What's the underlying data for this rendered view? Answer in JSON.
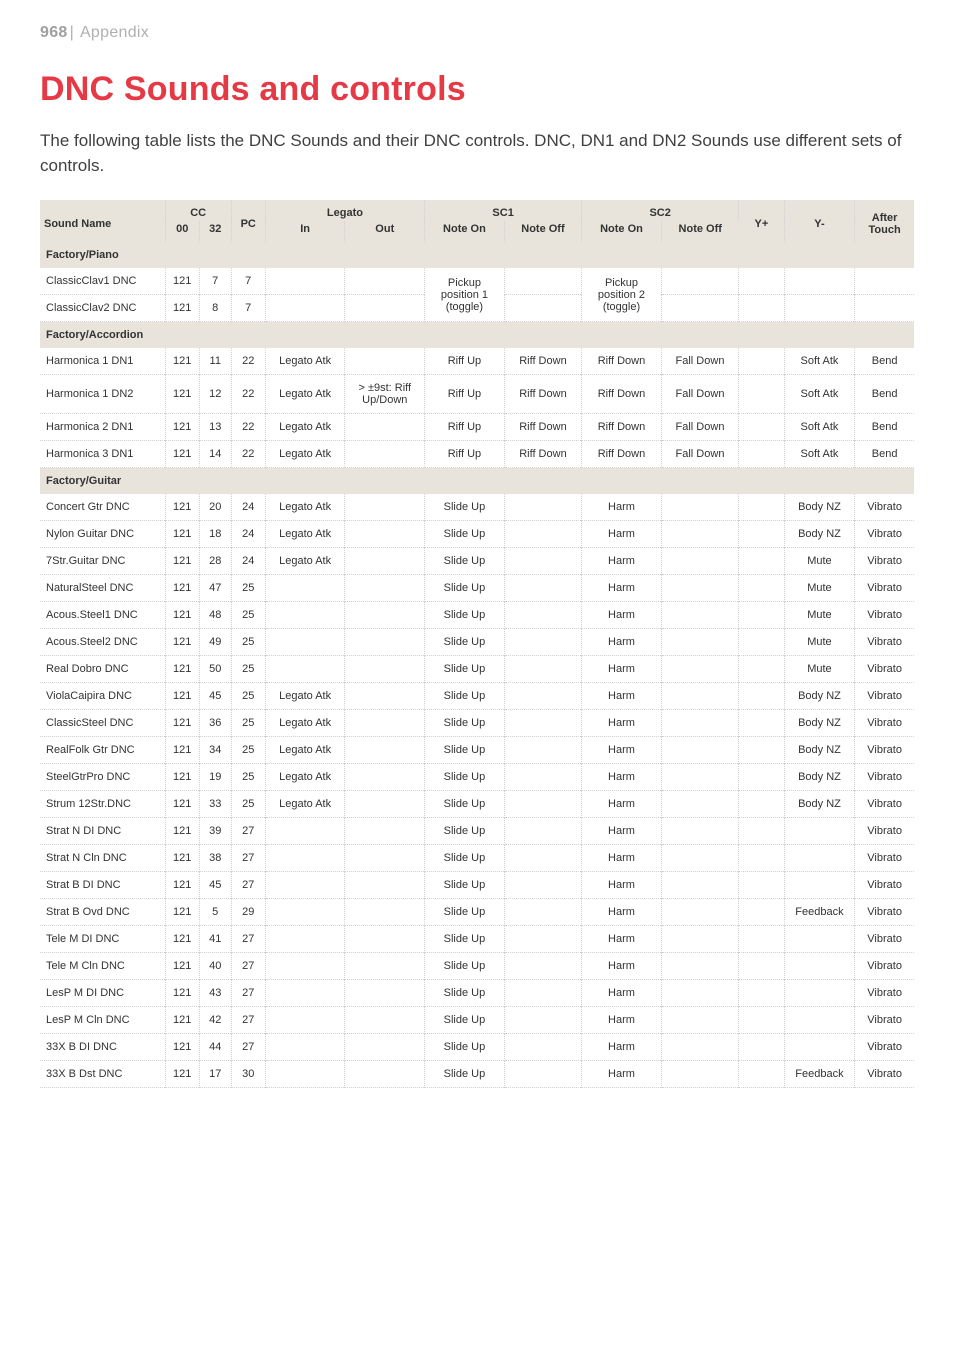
{
  "header": {
    "page_number": "968",
    "divider": "|",
    "section": "Appendix"
  },
  "title": "DNC Sounds and controls",
  "intro": "The following table lists the DNC Sounds and their DNC controls. DNC, DN1 and DN2 Sounds use different sets of controls.",
  "table": {
    "head_row1": {
      "sound_name": "Sound Name",
      "cc": "CC",
      "pc": "PC",
      "legato": "Legato",
      "sc1": "SC1",
      "sc2": "SC2",
      "yp": "Y+",
      "ym": "Y-",
      "after": "After Touch"
    },
    "head_row2": {
      "cc00": "00",
      "cc32": "32",
      "in": "In",
      "out": "Out",
      "noteon1": "Note On",
      "noteoff1": "Note Off",
      "noteon2": "Note On",
      "noteoff2": "Note Off"
    },
    "sections": [
      {
        "label": "Factory/Piano",
        "rows": [
          {
            "name": "ClassicClav1 DNC",
            "cc00": "121",
            "cc32": "7",
            "pc": "7",
            "legin": "",
            "legout": "",
            "sc1on": "Pickup position 1 (toggle)",
            "sc1off": "",
            "sc2on": "Pickup position 2 (toggle)",
            "sc2off": "",
            "yp": "",
            "ym": "",
            "after": "",
            "rowspan_sc1": 2,
            "rowspan_sc2": 2
          },
          {
            "name": "ClassicClav2 DNC",
            "cc00": "121",
            "cc32": "8",
            "pc": "7",
            "legin": "",
            "legout": "",
            "sc1off": "",
            "sc2off": "",
            "yp": "",
            "ym": "",
            "after": "",
            "skip_sc1": true,
            "skip_sc2": true
          }
        ]
      },
      {
        "label": "Factory/Accordion",
        "rows": [
          {
            "name": "Harmonica 1 DN1",
            "cc00": "121",
            "cc32": "11",
            "pc": "22",
            "legin": "Legato Atk",
            "legout": "",
            "sc1on": "Riff Up",
            "sc1off": "Riff Down",
            "sc2on": "Riff Down",
            "sc2off": "Fall Down",
            "yp": "",
            "ym": "Soft Atk",
            "after": "Bend"
          },
          {
            "name": "Harmonica 1 DN2",
            "cc00": "121",
            "cc32": "12",
            "pc": "22",
            "legin": "Legato Atk",
            "legout": "> ±9st: Riff Up/Down",
            "sc1on": "Riff Up",
            "sc1off": "Riff Down",
            "sc2on": "Riff Down",
            "sc2off": "Fall Down",
            "yp": "",
            "ym": "Soft Atk",
            "after": "Bend"
          },
          {
            "name": "Harmonica 2 DN1",
            "cc00": "121",
            "cc32": "13",
            "pc": "22",
            "legin": "Legato Atk",
            "legout": "",
            "sc1on": "Riff Up",
            "sc1off": "Riff Down",
            "sc2on": "Riff Down",
            "sc2off": "Fall Down",
            "yp": "",
            "ym": "Soft Atk",
            "after": "Bend"
          },
          {
            "name": "Harmonica 3 DN1",
            "cc00": "121",
            "cc32": "14",
            "pc": "22",
            "legin": "Legato Atk",
            "legout": "",
            "sc1on": "Riff Up",
            "sc1off": "Riff Down",
            "sc2on": "Riff Down",
            "sc2off": "Fall Down",
            "yp": "",
            "ym": "Soft Atk",
            "after": "Bend"
          }
        ]
      },
      {
        "label": "Factory/Guitar",
        "rows": [
          {
            "name": "Concert Gtr DNC",
            "cc00": "121",
            "cc32": "20",
            "pc": "24",
            "legin": "Legato Atk",
            "legout": "",
            "sc1on": "Slide Up",
            "sc1off": "",
            "sc2on": "Harm",
            "sc2off": "",
            "yp": "",
            "ym": "Body NZ",
            "after": "Vibrato"
          },
          {
            "name": "Nylon Guitar DNC",
            "cc00": "121",
            "cc32": "18",
            "pc": "24",
            "legin": "Legato Atk",
            "legout": "",
            "sc1on": "Slide Up",
            "sc1off": "",
            "sc2on": "Harm",
            "sc2off": "",
            "yp": "",
            "ym": "Body NZ",
            "after": "Vibrato"
          },
          {
            "name": "7Str.Guitar DNC",
            "cc00": "121",
            "cc32": "28",
            "pc": "24",
            "legin": "Legato Atk",
            "legout": "",
            "sc1on": "Slide Up",
            "sc1off": "",
            "sc2on": "Harm",
            "sc2off": "",
            "yp": "",
            "ym": "Mute",
            "after": "Vibrato"
          },
          {
            "name": "NaturalSteel DNC",
            "cc00": "121",
            "cc32": "47",
            "pc": "25",
            "legin": "",
            "legout": "",
            "sc1on": "Slide Up",
            "sc1off": "",
            "sc2on": "Harm",
            "sc2off": "",
            "yp": "",
            "ym": "Mute",
            "after": "Vibrato"
          },
          {
            "name": "Acous.Steel1 DNC",
            "cc00": "121",
            "cc32": "48",
            "pc": "25",
            "legin": "",
            "legout": "",
            "sc1on": "Slide Up",
            "sc1off": "",
            "sc2on": "Harm",
            "sc2off": "",
            "yp": "",
            "ym": "Mute",
            "after": "Vibrato"
          },
          {
            "name": "Acous.Steel2 DNC",
            "cc00": "121",
            "cc32": "49",
            "pc": "25",
            "legin": "",
            "legout": "",
            "sc1on": "Slide Up",
            "sc1off": "",
            "sc2on": "Harm",
            "sc2off": "",
            "yp": "",
            "ym": "Mute",
            "after": "Vibrato"
          },
          {
            "name": "Real Dobro DNC",
            "cc00": "121",
            "cc32": "50",
            "pc": "25",
            "legin": "",
            "legout": "",
            "sc1on": "Slide Up",
            "sc1off": "",
            "sc2on": "Harm",
            "sc2off": "",
            "yp": "",
            "ym": "Mute",
            "after": "Vibrato"
          },
          {
            "name": "ViolaCaipira DNC",
            "cc00": "121",
            "cc32": "45",
            "pc": "25",
            "legin": "Legato Atk",
            "legout": "",
            "sc1on": "Slide Up",
            "sc1off": "",
            "sc2on": "Harm",
            "sc2off": "",
            "yp": "",
            "ym": "Body NZ",
            "after": "Vibrato"
          },
          {
            "name": "ClassicSteel DNC",
            "cc00": "121",
            "cc32": "36",
            "pc": "25",
            "legin": "Legato Atk",
            "legout": "",
            "sc1on": "Slide Up",
            "sc1off": "",
            "sc2on": "Harm",
            "sc2off": "",
            "yp": "",
            "ym": "Body NZ",
            "after": "Vibrato"
          },
          {
            "name": "RealFolk Gtr DNC",
            "cc00": "121",
            "cc32": "34",
            "pc": "25",
            "legin": "Legato Atk",
            "legout": "",
            "sc1on": "Slide Up",
            "sc1off": "",
            "sc2on": "Harm",
            "sc2off": "",
            "yp": "",
            "ym": "Body NZ",
            "after": "Vibrato"
          },
          {
            "name": "SteelGtrPro DNC",
            "cc00": "121",
            "cc32": "19",
            "pc": "25",
            "legin": "Legato Atk",
            "legout": "",
            "sc1on": "Slide Up",
            "sc1off": "",
            "sc2on": "Harm",
            "sc2off": "",
            "yp": "",
            "ym": "Body NZ",
            "after": "Vibrato"
          },
          {
            "name": "Strum 12Str.DNC",
            "cc00": "121",
            "cc32": "33",
            "pc": "25",
            "legin": "Legato Atk",
            "legout": "",
            "sc1on": "Slide Up",
            "sc1off": "",
            "sc2on": "Harm",
            "sc2off": "",
            "yp": "",
            "ym": "Body NZ",
            "after": "Vibrato"
          },
          {
            "name": "Strat N DI DNC",
            "cc00": "121",
            "cc32": "39",
            "pc": "27",
            "legin": "",
            "legout": "",
            "sc1on": "Slide Up",
            "sc1off": "",
            "sc2on": "Harm",
            "sc2off": "",
            "yp": "",
            "ym": "",
            "after": "Vibrato"
          },
          {
            "name": "Strat N Cln DNC",
            "cc00": "121",
            "cc32": "38",
            "pc": "27",
            "legin": "",
            "legout": "",
            "sc1on": "Slide Up",
            "sc1off": "",
            "sc2on": "Harm",
            "sc2off": "",
            "yp": "",
            "ym": "",
            "after": "Vibrato"
          },
          {
            "name": "Strat B DI DNC",
            "cc00": "121",
            "cc32": "45",
            "pc": "27",
            "legin": "",
            "legout": "",
            "sc1on": "Slide Up",
            "sc1off": "",
            "sc2on": "Harm",
            "sc2off": "",
            "yp": "",
            "ym": "",
            "after": "Vibrato"
          },
          {
            "name": "Strat B Ovd DNC",
            "cc00": "121",
            "cc32": "5",
            "pc": "29",
            "legin": "",
            "legout": "",
            "sc1on": "Slide Up",
            "sc1off": "",
            "sc2on": "Harm",
            "sc2off": "",
            "yp": "",
            "ym": "Feedback",
            "after": "Vibrato"
          },
          {
            "name": "Tele M DI DNC",
            "cc00": "121",
            "cc32": "41",
            "pc": "27",
            "legin": "",
            "legout": "",
            "sc1on": "Slide Up",
            "sc1off": "",
            "sc2on": "Harm",
            "sc2off": "",
            "yp": "",
            "ym": "",
            "after": "Vibrato"
          },
          {
            "name": "Tele M Cln DNC",
            "cc00": "121",
            "cc32": "40",
            "pc": "27",
            "legin": "",
            "legout": "",
            "sc1on": "Slide Up",
            "sc1off": "",
            "sc2on": "Harm",
            "sc2off": "",
            "yp": "",
            "ym": "",
            "after": "Vibrato"
          },
          {
            "name": "LesP M DI DNC",
            "cc00": "121",
            "cc32": "43",
            "pc": "27",
            "legin": "",
            "legout": "",
            "sc1on": "Slide Up",
            "sc1off": "",
            "sc2on": "Harm",
            "sc2off": "",
            "yp": "",
            "ym": "",
            "after": "Vibrato"
          },
          {
            "name": "LesP M Cln DNC",
            "cc00": "121",
            "cc32": "42",
            "pc": "27",
            "legin": "",
            "legout": "",
            "sc1on": "Slide Up",
            "sc1off": "",
            "sc2on": "Harm",
            "sc2off": "",
            "yp": "",
            "ym": "",
            "after": "Vibrato"
          },
          {
            "name": "33X B DI DNC",
            "cc00": "121",
            "cc32": "44",
            "pc": "27",
            "legin": "",
            "legout": "",
            "sc1on": "Slide Up",
            "sc1off": "",
            "sc2on": "Harm",
            "sc2off": "",
            "yp": "",
            "ym": "",
            "after": "Vibrato"
          },
          {
            "name": "33X B Dst DNC",
            "cc00": "121",
            "cc32": "17",
            "pc": "30",
            "legin": "",
            "legout": "",
            "sc1on": "Slide Up",
            "sc1off": "",
            "sc2on": "Harm",
            "sc2off": "",
            "yp": "",
            "ym": "Feedback",
            "after": "Vibrato"
          }
        ]
      }
    ]
  }
}
